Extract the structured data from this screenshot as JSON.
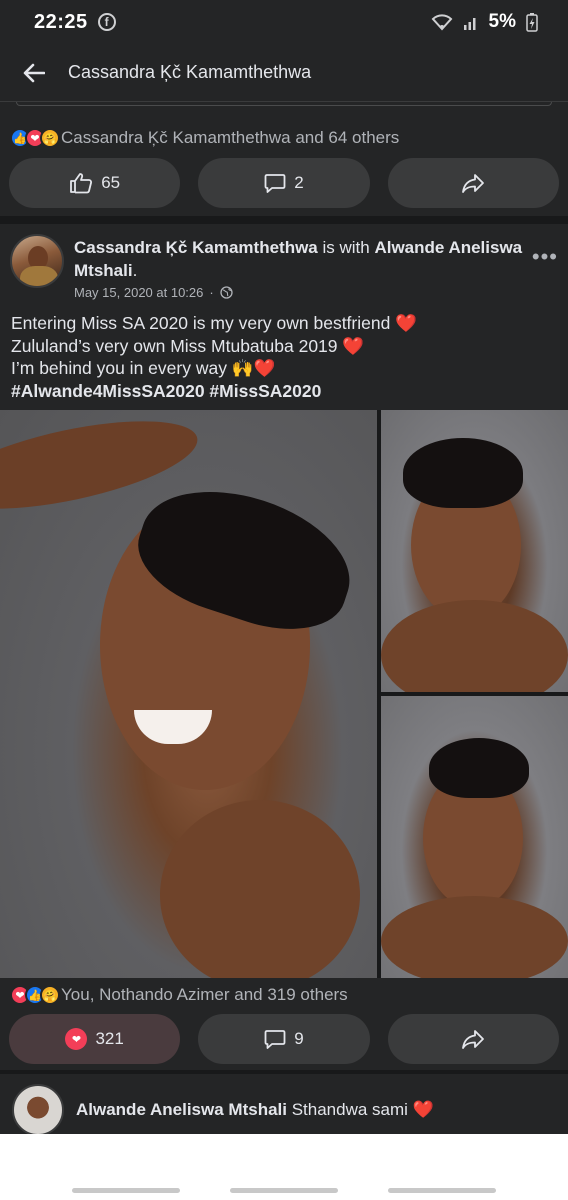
{
  "status_bar": {
    "time": "22:25",
    "fb_badge": "f",
    "battery": "5%"
  },
  "top_bar": {
    "title": "Cassandra Ķč Kamamthethwa"
  },
  "previous_post": {
    "reactions_text": "Cassandra Ķč Kamamthethwa and 64 others",
    "like_count": "65",
    "comment_count": "2"
  },
  "post": {
    "author": "Cassandra Ķč Kamamthethwa",
    "with_word": " is with ",
    "tagged": "Alwande Aneliswa Mtshali",
    "timestamp": "May 15, 2020 at 10:26",
    "dot": "·",
    "text_lines": [
      "Entering Miss SA 2020 is my very own bestfriend ",
      "Zululand’s very own Miss Mtubatuba 2019 ",
      "I’m behind you in every way 🙌"
    ],
    "hashtags": "#Alwande4MissSA2020 #MissSA2020",
    "reactions_text": "You, Nothando Azimer and 319 others",
    "love_count": "321",
    "comment_count": "9"
  },
  "comment": {
    "author": "Alwande Aneliswa Mtshali",
    "text": " Sthandwa sami "
  },
  "colors": {
    "background": "#242526",
    "accent_blue": "#1877f2",
    "love_red": "#f33e58",
    "heart_red": "#f02849"
  }
}
